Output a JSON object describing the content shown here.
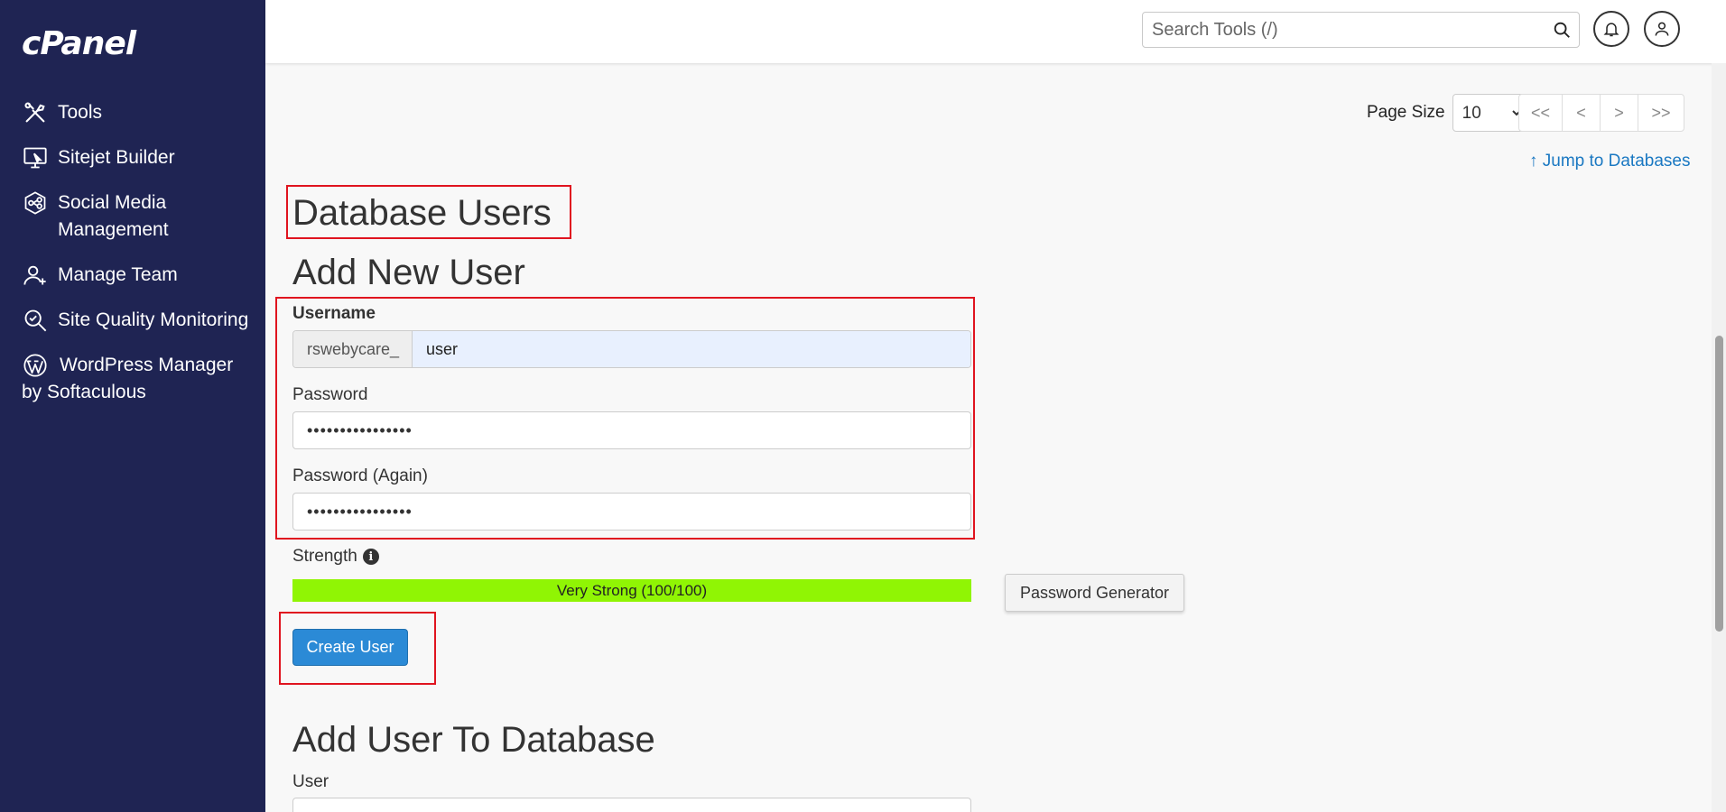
{
  "sidebar": {
    "logo": "cPanel",
    "items": [
      {
        "label": "Tools",
        "icon": "tools-icon"
      },
      {
        "label": "Sitejet Builder",
        "icon": "monitor-icon"
      },
      {
        "label": "Social Media Management",
        "icon": "network-icon"
      },
      {
        "label": "Manage Team",
        "icon": "user-add-icon"
      },
      {
        "label": "Site Quality Monitoring",
        "icon": "magnifier-check-icon"
      },
      {
        "label": "WordPress Manager by Softaculous",
        "icon": "wordpress-icon"
      }
    ]
  },
  "header": {
    "search_placeholder": "Search Tools (/)"
  },
  "pagination": {
    "page_size_label": "Page Size",
    "page_size_value": "10",
    "first": "<<",
    "prev": "<",
    "next": ">",
    "last": ">>"
  },
  "jump_link": "Jump to Databases",
  "section_title": "Database Users",
  "add_user": {
    "title": "Add New User",
    "username_label": "Username",
    "username_prefix": "rswebycare_",
    "username_value": "user",
    "password_label": "Password",
    "password_value": "••••••••••••••••",
    "password_again_label": "Password (Again)",
    "password_again_value": "••••••••••••••••",
    "strength_label": "Strength",
    "strength_text": "Very Strong (100/100)",
    "strength_fraction": 1.0,
    "password_generator_label": "Password Generator",
    "create_button_label": "Create User"
  },
  "add_to_db": {
    "title": "Add User To Database",
    "user_label": "User"
  },
  "colors": {
    "sidebar_bg": "#1f2453",
    "accent": "#2b8ad6",
    "strength": "#90f504",
    "annotation": "#e0141f"
  }
}
